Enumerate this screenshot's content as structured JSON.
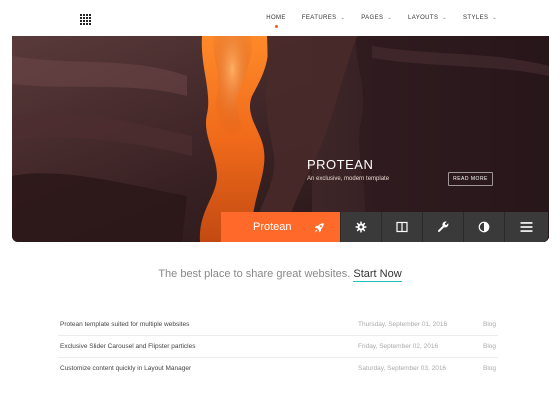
{
  "nav": {
    "items": [
      {
        "label": "HOME",
        "active": true,
        "dropdown": false
      },
      {
        "label": "FEATURES",
        "active": false,
        "dropdown": true
      },
      {
        "label": "PAGES",
        "active": false,
        "dropdown": true
      },
      {
        "label": "LAYOUTS",
        "active": false,
        "dropdown": true
      },
      {
        "label": "STYLES",
        "active": false,
        "dropdown": true
      }
    ],
    "accent_dot_color": "#ff5a1f"
  },
  "hero": {
    "title": "PROTEAN",
    "subtitle": "An exclusive, modern template",
    "button_label": "READ MORE"
  },
  "toolbar": {
    "brand_label": "Protean",
    "brand_color": "#ff6a2b",
    "icons": [
      "rocket-icon",
      "gear-icon",
      "columns-icon",
      "wrench-icon",
      "contrast-icon",
      "menu-icon"
    ]
  },
  "tagline": {
    "text": "The best place to share great websites.",
    "link_label": "Start Now",
    "link_underline_color": "#1fc2b7"
  },
  "articles": [
    {
      "title": "Protean template suited for multiple websites",
      "date": "Thursday, September 01, 2016",
      "category": "Blog"
    },
    {
      "title": "Exclusive Slider Carousel and Flipster particles",
      "date": "Friday, September 02, 2016",
      "category": "Blog"
    },
    {
      "title": "Customize content quickly in Layout Manager",
      "date": "Saturday, September 03, 2016",
      "category": "Blog"
    }
  ]
}
